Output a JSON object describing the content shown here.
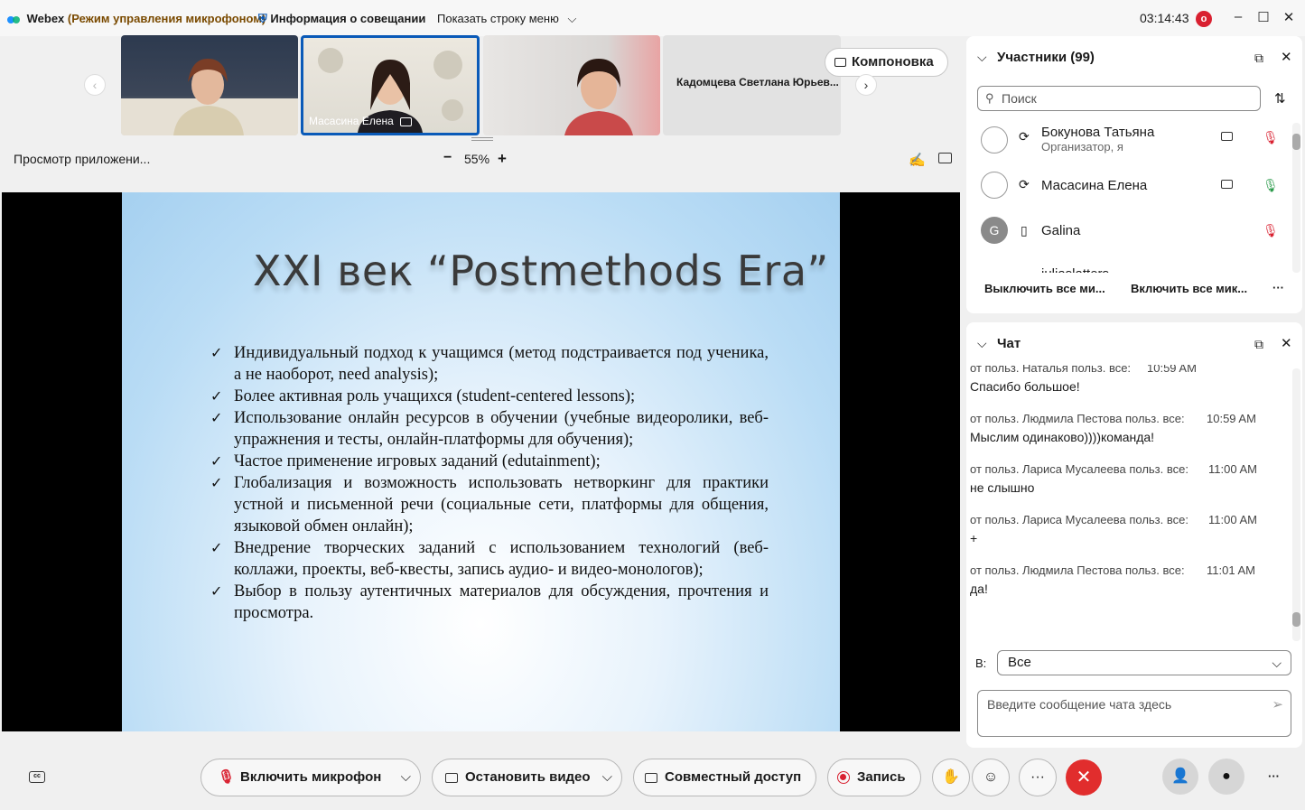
{
  "top_bar": {
    "app_name": "Webex",
    "mode": "(Режим управления микрофоном)",
    "meeting_info": "Информация о совещании",
    "show_menu": "Показать строку меню",
    "timer": "03:14:43",
    "rec_badge": "o"
  },
  "video_strip": {
    "tiles": [
      {
        "name": ""
      },
      {
        "name": "Масасина Елена"
      },
      {
        "name": ""
      },
      {
        "name": "Кадомцева Светлана Юрьев..."
      }
    ],
    "layout_label": "Компоновка"
  },
  "app_view": {
    "label": "Просмотр приложени...",
    "zoom": "55%",
    "zoom_minus": "−",
    "zoom_plus": "+"
  },
  "slide": {
    "title": "XXI век “Postmethods Era”",
    "bullets": [
      "Индивидуальный подход к учащимся (метод подстраивается под ученика, а не наоборот, need analysis);",
      "Более активная роль учащихся (student-centered lessons);",
      "Использование онлайн ресурсов в обучении (учебные видеоролики, веб- упражнения и тесты, онлайн-платформы для обучения);",
      "Частое применение игровых заданий (edutainment);",
      "Глобализация и возможность использовать нетворкинг для практики устной и письменной речи (социальные сети, платформы для общения, языковой обмен онлайн);",
      "Внедрение творческих заданий с использованием технологий (веб-коллажи, проекты, веб-квесты, запись аудио- и видео-монологов);",
      "Выбор в пользу аутентичных материалов для обсуждения, прочтения и просмотра."
    ]
  },
  "participants": {
    "title": "Участники (99)",
    "search_placeholder": "Поиск",
    "list": [
      {
        "name": "Бокунова Татьяна",
        "role": "Организатор, я",
        "avatar": ""
      },
      {
        "name": "Масасина Елена",
        "role": "",
        "avatar": ""
      },
      {
        "name": "Galina",
        "role": "",
        "avatar": "G"
      },
      {
        "name": "juliaslatters",
        "role": "",
        "avatar": ""
      }
    ],
    "mute_all": "Выключить все ми...",
    "unmute_all": "Включить все мик...",
    "more": "···"
  },
  "chat": {
    "title": "Чат",
    "messages": [
      {
        "from": "от польз. Наталья польз. все:",
        "time": "10:59 AM",
        "text": "Спасибо большое!"
      },
      {
        "from": "от польз. Людмила Пестова польз. все:",
        "time": "10:59 AM",
        "text": "Мыслим одинаково))))команда!"
      },
      {
        "from": "от польз. Лариса Мусалеева польз. все:",
        "time": "11:00 AM",
        "text": "не слышно"
      },
      {
        "from": "от польз. Лариса Мусалеева польз. все:",
        "time": "11:00 AM",
        "text": "+"
      },
      {
        "from": "от польз. Людмила Пестова польз. все:",
        "time": "11:01 AM",
        "text": "да!"
      }
    ],
    "to_label": "В:",
    "to_value": "Все",
    "input_placeholder": "Введите сообщение чата здесь"
  },
  "bottom_bar": {
    "unmute": "Включить микрофон",
    "stop_video": "Остановить видео",
    "share": "Совместный доступ",
    "record": "Запись",
    "more": "···",
    "overflow": "···"
  },
  "colors": {
    "accent": "#0a5ab8",
    "end_call": "#e12d2d",
    "muted": "#d92030",
    "mic_on": "#2a9a4a"
  }
}
